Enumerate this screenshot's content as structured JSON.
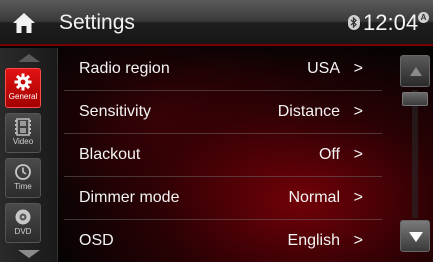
{
  "header": {
    "title": "Settings",
    "time": "12:04",
    "alarm_badge": "A",
    "home_icon": "home-icon",
    "bluetooth_icon": "bluetooth-icon"
  },
  "sidebar": {
    "items": [
      {
        "label": "General",
        "icon": "gear-icon",
        "active": true
      },
      {
        "label": "Video",
        "icon": "film-icon",
        "active": false
      },
      {
        "label": "Time",
        "icon": "clock-icon",
        "active": false
      },
      {
        "label": "DVD",
        "icon": "disc-icon",
        "active": false
      }
    ]
  },
  "settings": {
    "rows": [
      {
        "label": "Radio region",
        "value": "USA",
        "chevron": ">"
      },
      {
        "label": "Sensitivity",
        "value": "Distance",
        "chevron": ">"
      },
      {
        "label": "Blackout",
        "value": "Off",
        "chevron": ">"
      },
      {
        "label": "Dimmer mode",
        "value": "Normal",
        "chevron": ">"
      },
      {
        "label": "OSD",
        "value": "English",
        "chevron": ">"
      }
    ]
  },
  "colors": {
    "accent": "#d40000",
    "background": "#070303",
    "header": "#2a2a2a"
  }
}
